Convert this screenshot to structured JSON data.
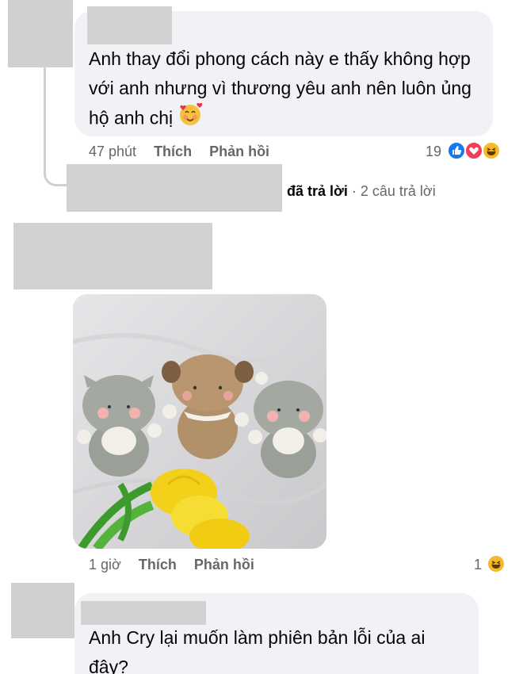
{
  "comment1": {
    "text": "Anh thay đổi phong cách này e thấy không hợp với anh nhưng vì thương yêu anh nên luôn ủng hộ anh chị",
    "emoji": "smiling-face-with-hearts",
    "time": "47 phút",
    "like_label": "Thích",
    "reply_label": "Phản hồi",
    "reaction_count": "19",
    "reactions": [
      "like",
      "love",
      "haha"
    ]
  },
  "replies": {
    "replied_text": "đã trả lời",
    "separator": "·",
    "count_text": "2 câu trả lời"
  },
  "comment2": {
    "image": "knitted-toy-animals-with-yellow-tulips",
    "time": "1 giờ",
    "like_label": "Thích",
    "reply_label": "Phản hồi",
    "reaction_count": "1",
    "reactions": [
      "haha"
    ]
  },
  "comment3": {
    "text": "Anh Cry lại muốn làm phiên bản lỗi của ai đây?"
  },
  "colors": {
    "bubble": "#f0f2f5",
    "redaction": "#d2d2d2",
    "secondary_text": "#65676b",
    "like_blue": "#1877f2",
    "love_red": "#f33e58",
    "haha_yellow": "#f7b928"
  }
}
